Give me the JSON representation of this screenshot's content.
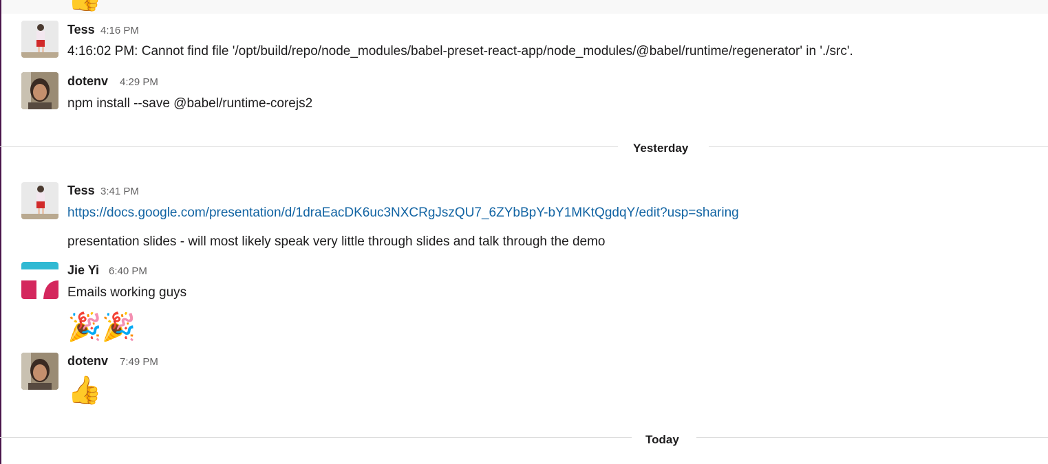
{
  "top": {
    "reaction_emoji": "👍"
  },
  "messages": [
    {
      "author": "Tess",
      "time": "4:16 PM",
      "avatar_icon": "tess-avatar",
      "text": "4:16:02 PM: Cannot find file '/opt/build/repo/node_modules/babel-preset-react-app/node_modules/@babel/runtime/regenerator' in './src'."
    },
    {
      "author": "dotenv",
      "time": "4:29 PM",
      "avatar_icon": "dotenv-avatar",
      "text": "npm install --save @babel/runtime-corejs2"
    },
    {
      "author": "Tess",
      "time": "3:41 PM",
      "avatar_icon": "tess-avatar",
      "link": "https://docs.google.com/presentation/d/1draEacDK6uc3NXCRgJszQU7_6ZYbBpY-bY1MKtQgdqY/edit?usp=sharing",
      "text": "presentation slides - will most likely speak very little through slides and talk through the demo"
    },
    {
      "author": "Jie Yi",
      "time": "6:40 PM",
      "avatar_icon": "jieyi-avatar",
      "text": "Emails working guys",
      "emoji": "🎉🎉"
    },
    {
      "author": "dotenv",
      "time": "7:49 PM",
      "avatar_icon": "dotenv-avatar",
      "emoji": "👍"
    }
  ],
  "dividers": {
    "yesterday": "Yesterday",
    "today": "Today"
  },
  "colors": {
    "link": "#1264a3",
    "sidebar_edge": "#4a154b",
    "jieyi_blue": "#2fb9d3",
    "jieyi_red": "#d4275d"
  }
}
